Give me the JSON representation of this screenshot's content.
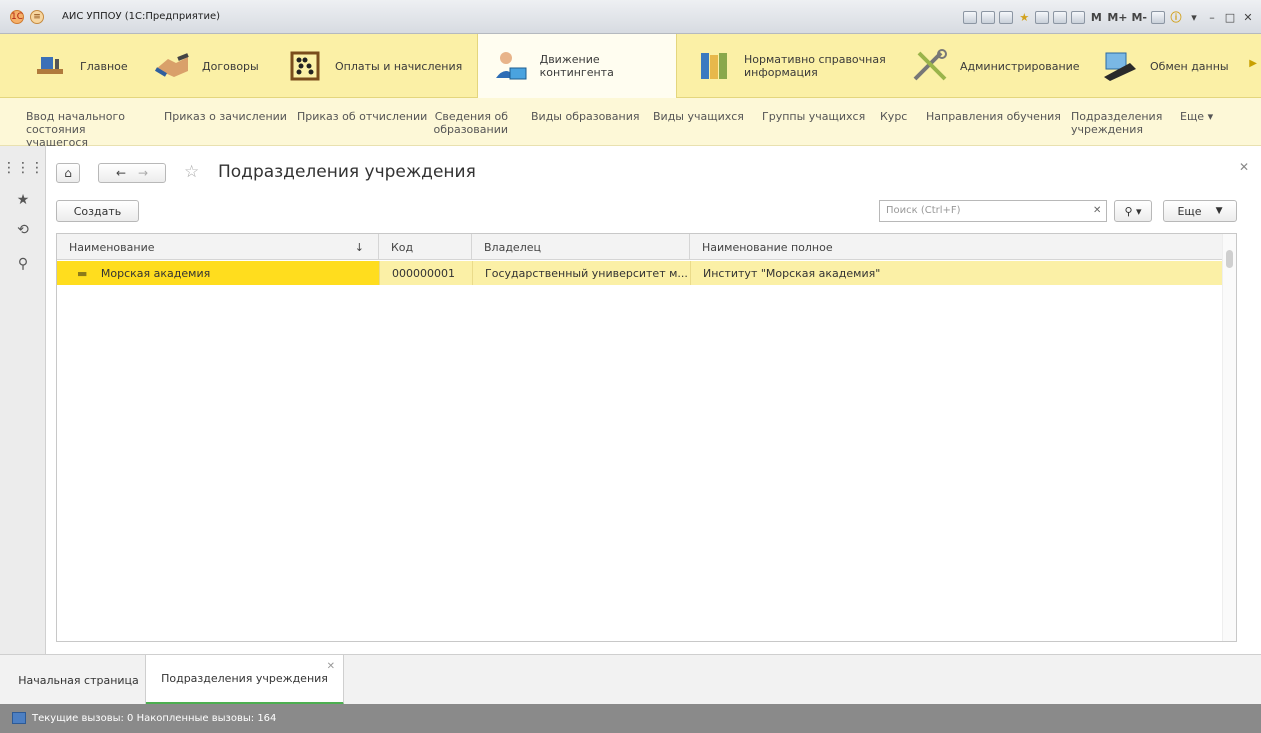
{
  "window": {
    "title": "АИС УППОУ (1С:Предприятие)",
    "tools": [
      "M",
      "M+",
      "M-"
    ]
  },
  "sections": [
    {
      "label": "Главное",
      "icon": "desk-icon"
    },
    {
      "label": "Договоры",
      "icon": "handshake-icon"
    },
    {
      "label": "Оплаты и начисления",
      "icon": "abacus-icon"
    },
    {
      "label": "Движение контингента",
      "icon": "person-card-icon"
    },
    {
      "label": "Нормативно справочная информация",
      "icon": "binders-icon"
    },
    {
      "label": "Администрирование",
      "icon": "tools-icon"
    },
    {
      "label": "Обмен данны",
      "icon": "data-exchange-icon"
    }
  ],
  "commands": [
    "Ввод начального состояния учащегося",
    "Приказ о зачислении",
    "Приказ об отчислении",
    "Сведения об образовании",
    "Виды образования",
    "Виды учащихся",
    "Группы учащихся",
    "Курс",
    "Направления обучения",
    "Подразделения учреждения",
    "Еще ▾"
  ],
  "form": {
    "title": "Подразделения учреждения",
    "create_label": "Создать",
    "search_placeholder": "Поиск (Ctrl+F)",
    "more_label": "Еще",
    "columns": [
      "Наименование",
      "Код",
      "Владелец",
      "Наименование полное"
    ],
    "sort_indicator": "↓",
    "rows": [
      {
        "name": "Морская академия",
        "code": "000000001",
        "owner": "Государственный университет м...",
        "full_name": "Институт \"Морская академия\""
      }
    ]
  },
  "tabs": [
    {
      "label": "Начальная страница"
    },
    {
      "label": "Подразделения учреждения"
    }
  ],
  "status": {
    "text": "Текущие вызовы: 0   Накопленные вызовы: 164"
  },
  "colors": {
    "section_bar": "#fbf0a6",
    "command_bar": "#fdf8d7",
    "selected_cell": "#ffdd1e",
    "active_tab_underline": "#4caf50"
  }
}
